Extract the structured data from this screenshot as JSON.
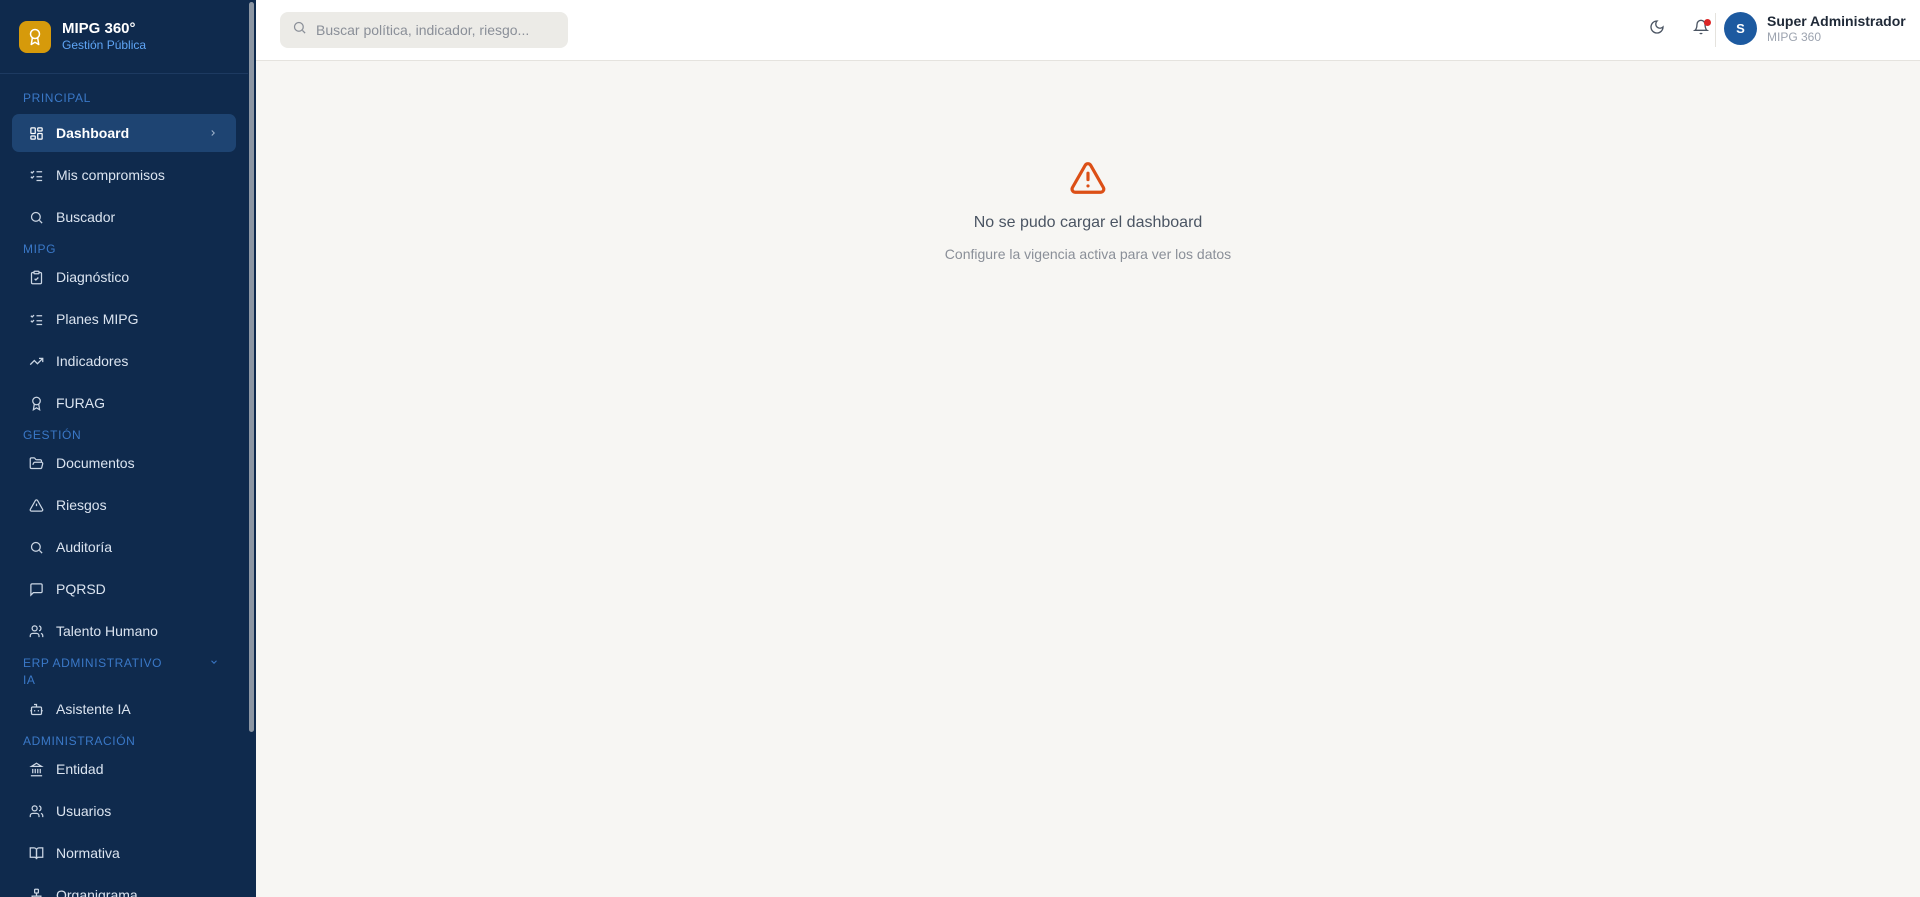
{
  "brand": {
    "name": "MIPG 360°",
    "subtitle": "Gestión Pública",
    "accent": "#d69a0b"
  },
  "sidebar": {
    "sections": {
      "principal": "PRINCIPAL",
      "mipg": "MIPG",
      "gestion": "GESTIÓN",
      "erp": "ERP ADMINISTRATIVO IA",
      "admin": "ADMINISTRACIÓN"
    },
    "items": [
      {
        "label": "Dashboard",
        "icon": "grid-icon",
        "active": true
      },
      {
        "label": "Mis compromisos",
        "icon": "list-checks-icon"
      },
      {
        "label": "Buscador",
        "icon": "search-icon"
      },
      {
        "label": "Diagnóstico",
        "icon": "clipboard-check-icon"
      },
      {
        "label": "Planes MIPG",
        "icon": "list-checks-icon"
      },
      {
        "label": "Indicadores",
        "icon": "trending-up-icon"
      },
      {
        "label": "FURAG",
        "icon": "award-icon"
      },
      {
        "label": "Documentos",
        "icon": "folder-open-icon"
      },
      {
        "label": "Riesgos",
        "icon": "alert-triangle-icon"
      },
      {
        "label": "Auditoría",
        "icon": "search-icon"
      },
      {
        "label": "PQRSD",
        "icon": "message-square-icon"
      },
      {
        "label": "Talento Humano",
        "icon": "users-icon"
      },
      {
        "label": "Asistente IA",
        "icon": "bot-icon"
      },
      {
        "label": "Entidad",
        "icon": "landmark-icon"
      },
      {
        "label": "Usuarios",
        "icon": "users-icon"
      },
      {
        "label": "Normativa",
        "icon": "book-open-icon"
      },
      {
        "label": "Organigrama",
        "icon": "network-icon"
      }
    ]
  },
  "header": {
    "search_placeholder": "Buscar política, indicador, riesgo...",
    "user": {
      "initial": "S",
      "name": "Super Administrador",
      "subtitle": "MIPG 360"
    }
  },
  "main": {
    "error_title": "No se pudo cargar el dashboard",
    "error_subtitle": "Configure la vigencia activa para ver los datos",
    "warning_color": "#dc4f16"
  }
}
